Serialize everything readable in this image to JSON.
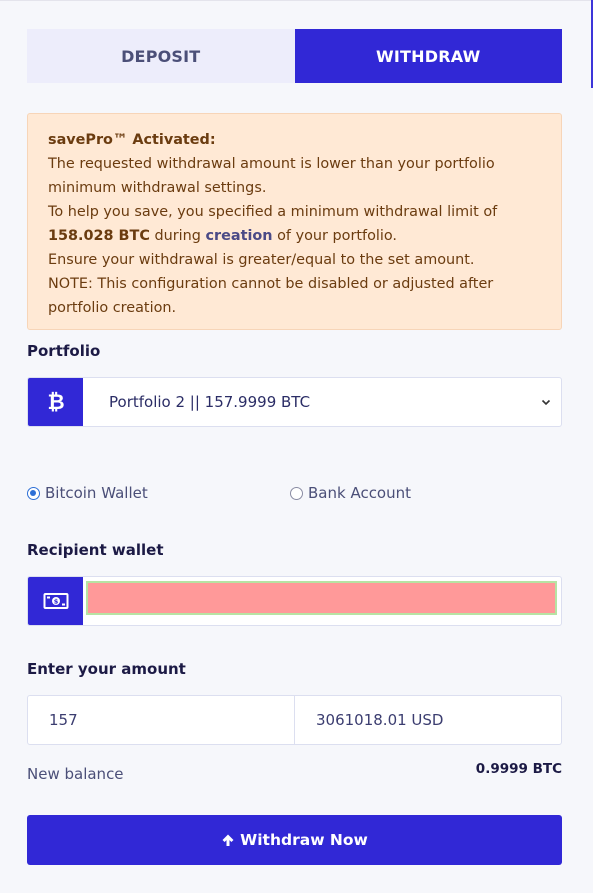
{
  "tabs": {
    "deposit_label": "DEPOSIT",
    "withdraw_label": "WITHDRAW"
  },
  "alert": {
    "title": "savePro™ Activated:",
    "line1": "The requested withdrawal amount is lower than your portfolio minimum withdrawal settings.",
    "line2_prefix": "To help you save, you specified a minimum withdrawal limit of",
    "min_amount": "158.028 BTC",
    "line2_mid": "during",
    "link": "creation",
    "line2_suffix": "of your portfolio.",
    "line3": "Ensure your withdrawal is greater/equal to the set amount.",
    "line4": "NOTE: This configuration cannot be disabled or adjusted after portfolio creation."
  },
  "portfolio": {
    "label": "Portfolio",
    "selected": "Portfolio 2 || 157.9999 BTC",
    "icon": "bitcoin-icon"
  },
  "method": {
    "options": [
      "Bitcoin Wallet",
      "Bank Account"
    ],
    "selected": "Bitcoin Wallet"
  },
  "recipient": {
    "label": "Recipient wallet",
    "value": "",
    "icon": "money-bill-icon"
  },
  "amount": {
    "label": "Enter your amount",
    "btc_value": "157",
    "usd_value": "3061018.01 USD"
  },
  "balance": {
    "label": "New balance",
    "value": "0.9999 BTC"
  },
  "submit": {
    "label": "Withdraw Now",
    "icon": "arrow-up-icon"
  },
  "colors": {
    "primary": "#3128d6",
    "alert_bg": "#ffe9d5",
    "alert_text": "#6b3c10",
    "wallet_field": "#ff9999"
  }
}
